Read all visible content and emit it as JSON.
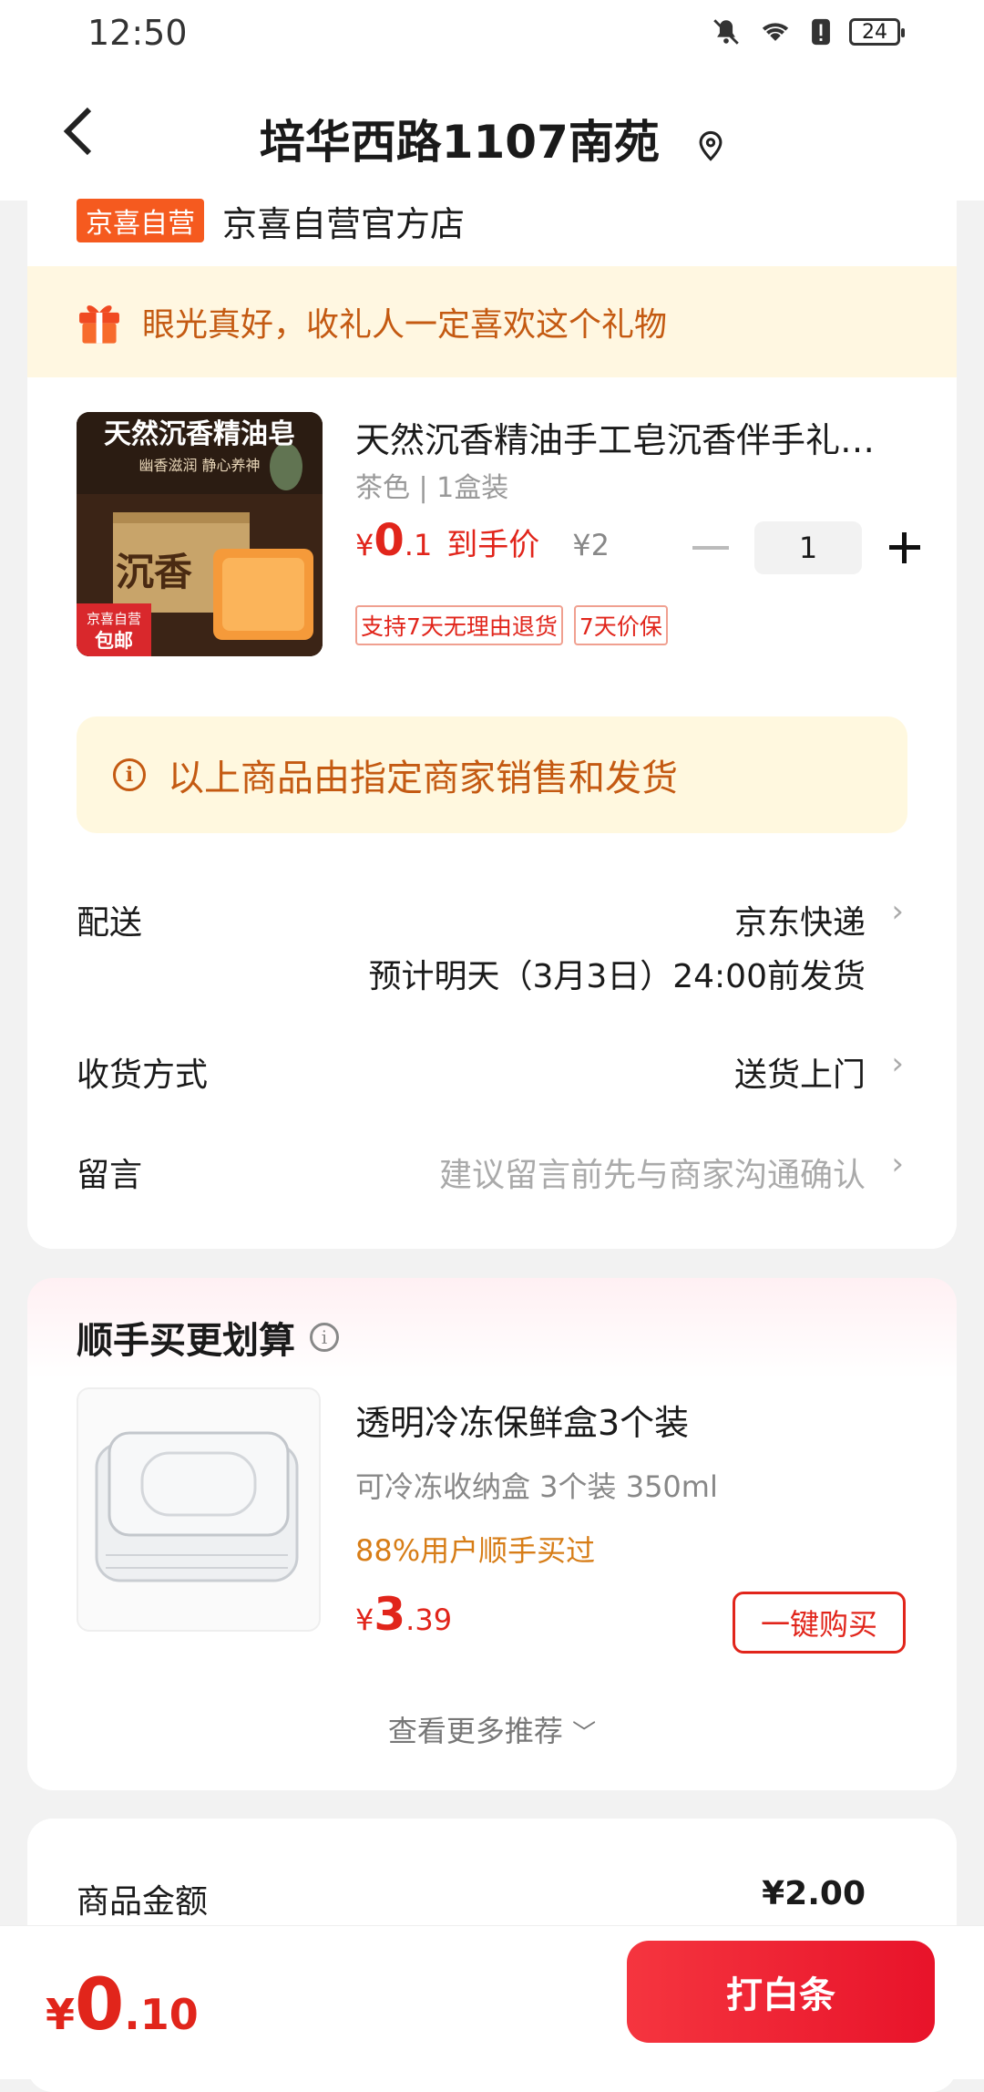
{
  "status_bar": {
    "time": "12:50",
    "battery": "24"
  },
  "header": {
    "title": "培华西路1107南苑"
  },
  "store": {
    "tag": "京喜自营",
    "name": "京喜自营官方店"
  },
  "gift_banner": {
    "text": "眼光真好，收礼人一定喜欢这个礼物"
  },
  "product": {
    "image_top_text": "天然沉香精油皂",
    "image_sub_text": "幽香滋润 静心养神",
    "image_badge_top": "京喜自营",
    "image_badge_bottom": "包邮",
    "image_box_text": "沉香",
    "title": "天然沉香精油手工皂沉香伴手礼…",
    "spec": "茶色 | 1盒装",
    "price_symbol": "¥",
    "price_int": "0",
    "price_dec": ".1",
    "price_label": "到手价",
    "original_price": "¥2",
    "quantity": "1",
    "badges": [
      "支持7天无理由退货",
      "7天价保"
    ]
  },
  "notice": {
    "text": "以上商品由指定商家销售和发货"
  },
  "delivery": {
    "label": "配送",
    "value": "京东快递",
    "estimate": "预计明天（3月3日）24:00前发货"
  },
  "receive_method": {
    "label": "收货方式",
    "value": "送货上门"
  },
  "message": {
    "label": "留言",
    "placeholder": "建议留言前先与商家沟通确认"
  },
  "recommend": {
    "title": "顺手买更划算",
    "item": {
      "title": "透明冷冻保鲜盒3个装",
      "spec": "可冷冻收纳盒 3个装 350ml",
      "pct": "88%用户顺手买过",
      "price_symbol": "¥",
      "price_int": "3",
      "price_dec": ".39",
      "buy_label": "一键购买"
    },
    "more_label": "查看更多推荐"
  },
  "summary": {
    "label": "商品金额",
    "value": "¥2.00"
  },
  "footer": {
    "price_symbol": "¥",
    "price_int": "0",
    "price_dec": ".10",
    "pay_label": "打白条"
  },
  "colors": {
    "accent": "#e1251b",
    "warning_text": "#c45a12",
    "banner_bg": "#fff7e1",
    "store_tag": "#f55a1f"
  }
}
